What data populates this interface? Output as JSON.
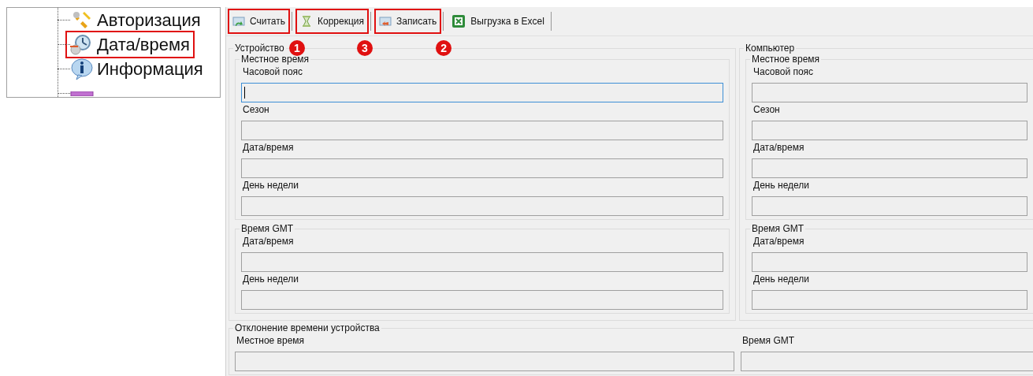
{
  "tree": {
    "items": [
      {
        "label": "Авторизация",
        "kind": "keys",
        "highlighted": false
      },
      {
        "label": "Дата/время",
        "kind": "clock",
        "highlighted": true
      },
      {
        "label": "Информация",
        "kind": "info",
        "highlighted": false
      },
      {
        "kind": "bar",
        "highlighted": false
      }
    ]
  },
  "toolbar": [
    {
      "label": "Считать",
      "kind": "read",
      "highlighted": true,
      "badge": "1"
    },
    {
      "label": "Коррекция",
      "kind": "hourglass",
      "highlighted": true,
      "badge": "3"
    },
    {
      "label": "Записать",
      "kind": "write",
      "highlighted": true,
      "badge": "2"
    },
    {
      "label": "Выгрузка в Excel",
      "kind": "excel",
      "highlighted": false
    }
  ],
  "panels": [
    {
      "title": "Устройство",
      "groups": [
        {
          "title": "Местное время",
          "fields": [
            {
              "label": "Часовой пояс",
              "focused": true
            },
            {
              "label": "Сезон",
              "focused": false
            },
            {
              "label": "Дата/время",
              "focused": false
            },
            {
              "label": "День недели",
              "focused": false
            }
          ]
        },
        {
          "title": "Время GMT",
          "fields": [
            {
              "label": "Дата/время",
              "focused": false
            },
            {
              "label": "День недели",
              "focused": false
            }
          ]
        }
      ]
    },
    {
      "title": "Компьютер",
      "groups": [
        {
          "title": "Местное время",
          "fields": [
            {
              "label": "Часовой пояс",
              "focused": false
            },
            {
              "label": "Сезон",
              "focused": false
            },
            {
              "label": "Дата/время",
              "focused": false
            },
            {
              "label": "День недели",
              "focused": false
            }
          ]
        },
        {
          "title": "Время GMT",
          "fields": [
            {
              "label": "Дата/время",
              "focused": false
            },
            {
              "label": "День недели",
              "focused": false
            }
          ]
        }
      ]
    }
  ],
  "deviation": {
    "title": "Отклонение времени устройства",
    "fields": [
      {
        "label": "Местное время",
        "focused": false
      },
      {
        "label": "Время GMT",
        "focused": false
      }
    ]
  }
}
